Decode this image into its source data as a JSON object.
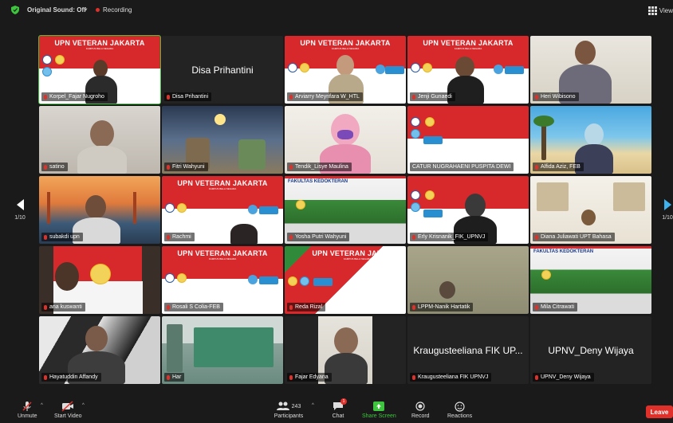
{
  "topbar": {
    "sound_label": "Original Sound: Off",
    "recording_label": "Recording",
    "view_label": "View"
  },
  "pager": {
    "left_label": "1/10",
    "right_label": "1/10"
  },
  "participants": [
    {
      "name": "Korpel_Fajar Nugroho",
      "kind": "upn",
      "active": true
    },
    {
      "name": "Disa Prihantini",
      "kind": "name",
      "big": "Disa Prihantini"
    },
    {
      "name": "Arviarry Meyrifara W_HTL",
      "kind": "upn"
    },
    {
      "name": "Jenji Gunaedi",
      "kind": "upn"
    },
    {
      "name": "Heri Wibisono",
      "kind": "cam"
    },
    {
      "name": "satino",
      "kind": "cam"
    },
    {
      "name": "Fitri Wahyuni",
      "kind": "cam"
    },
    {
      "name": "Tendik_Lisye Maulina",
      "kind": "cam"
    },
    {
      "name": "CATUR NUGRAHAENI PUSPITA DEWI",
      "kind": "upn"
    },
    {
      "name": "Alfida Aziz, FEB",
      "kind": "cam"
    },
    {
      "name": "subakdi upn",
      "kind": "cam"
    },
    {
      "name": "Rachmi",
      "kind": "upn"
    },
    {
      "name": "Yosha Putri Wahyuni",
      "kind": "fk"
    },
    {
      "name": "Erly Krisnanik_FIK_UPNVJ",
      "kind": "upn"
    },
    {
      "name": "Diana Juliawati UPT Bahasa",
      "kind": "cam"
    },
    {
      "name": "ana kuswanti",
      "kind": "cam"
    },
    {
      "name": "Rosali S Colia-FEB",
      "kind": "upn"
    },
    {
      "name": "Reda Rizal",
      "kind": "upn"
    },
    {
      "name": "LPPM-Nanik Hartatik",
      "kind": "cam"
    },
    {
      "name": "Mila Citrawati",
      "kind": "fk"
    },
    {
      "name": "Hayatuddin Affandy",
      "kind": "cam"
    },
    {
      "name": "Har",
      "kind": "cam"
    },
    {
      "name": "Fajar Edyana",
      "kind": "cam"
    },
    {
      "name": "Kraugusteeliana FIK UPNVJ",
      "kind": "name",
      "big": "Kraugusteeliana FIK UP..."
    },
    {
      "name": "UPNV_Deny Wijaya",
      "kind": "name",
      "big": "UPNV_Deny Wijaya"
    }
  ],
  "upn": {
    "title": "UPN VETERAN JAKARTA",
    "subtitle": "KAMPUS BELA NEGARA"
  },
  "fk": {
    "title": "FAKULTAS KEDOKTERAN"
  },
  "toolbar": {
    "unmute": "Unmute",
    "start_video": "Start Video",
    "participants": "Participants",
    "participants_count": "243",
    "chat": "Chat",
    "chat_badge": "1",
    "share_screen": "Share Screen",
    "record": "Record",
    "reactions": "Reactions",
    "leave": "Leave"
  },
  "colors": {
    "active_speaker": "#3ec43e",
    "leave": "#e0302a",
    "background": "#1a1a1a"
  }
}
